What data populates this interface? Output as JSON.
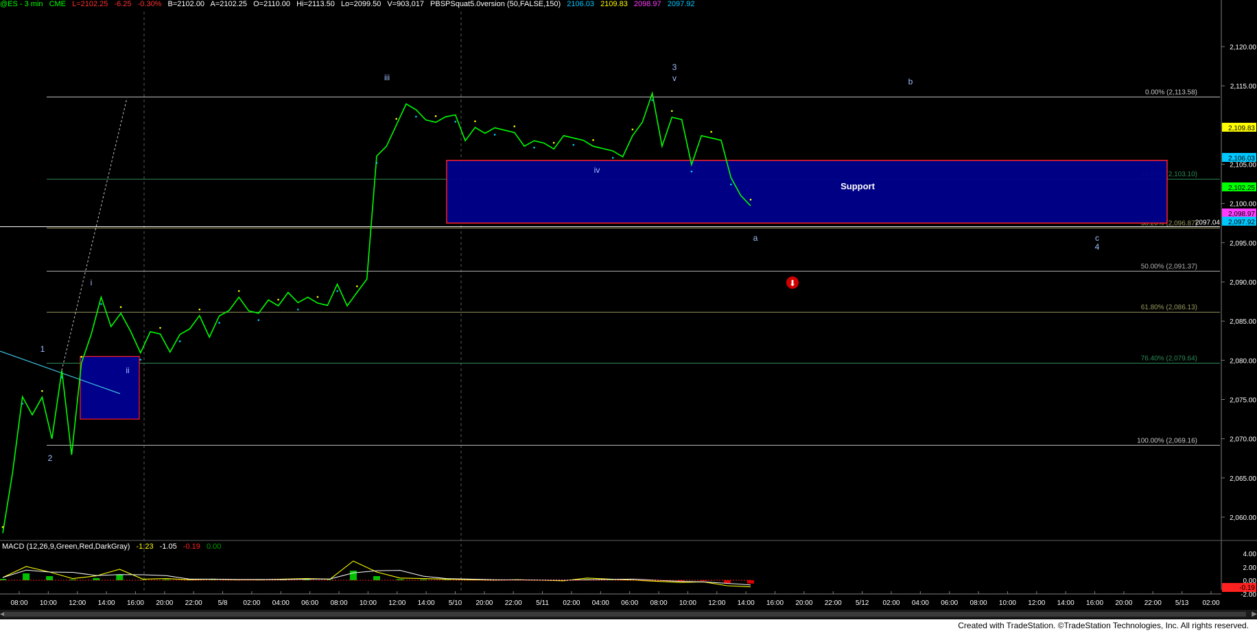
{
  "header": {
    "symbol": "@ES - 3 min",
    "exchange": "CME",
    "last": "L=2102.25",
    "change": "-6.25",
    "change_pct": "-0.30%",
    "bid": "B=2102.00",
    "ask": "A=2102.25",
    "open": "O=2110.00",
    "high": "Hi=2113.50",
    "low": "Lo=2099.50",
    "volume": "V=903,017",
    "indicator": "PBSPSquat5.0version (50,FALSE,150)",
    "ind_values": [
      {
        "text": "2106.03",
        "color": "#00c8ff"
      },
      {
        "text": "2109.83",
        "color": "#ffff00"
      },
      {
        "text": "2098.97",
        "color": "#ff3cff"
      },
      {
        "text": "2097.92",
        "color": "#00c8ff"
      }
    ]
  },
  "macd": {
    "label": "MACD (12,26,9,Green,Red,DarkGray)",
    "values": [
      {
        "text": "-1.23",
        "color": "#ffff00"
      },
      {
        "text": "-1.05",
        "color": "#ffffff"
      },
      {
        "text": "-0.19",
        "color": "#ff2020"
      },
      {
        "text": "0.00",
        "color": "#00a000"
      }
    ],
    "axis": [
      "4.00",
      "2.00",
      "0.00",
      "-2.00"
    ],
    "last_tag": "-0.19"
  },
  "price_axis": {
    "ticks": [
      "2,120.00",
      "2,115.00",
      "2,110.00",
      "2,105.00",
      "2,100.00",
      "2,095.00",
      "2,090.00",
      "2,085.00",
      "2,080.00",
      "2,075.00",
      "2,070.00",
      "2,065.00",
      "2,060.00"
    ],
    "tags": [
      {
        "text": "2,109.83",
        "value": 2109.83,
        "bg": "#ffff00",
        "fg": "#000000"
      },
      {
        "text": "2,106.03",
        "value": 2106.03,
        "bg": "#00c8ff",
        "fg": "#000000"
      },
      {
        "text": "2,102.25",
        "value": 2102.25,
        "bg": "#00ff00",
        "fg": "#000000"
      },
      {
        "text": "2,098.97",
        "value": 2098.97,
        "bg": "#ff3cff",
        "fg": "#000000"
      },
      {
        "text": "2,097.92",
        "value": 2097.92,
        "bg": "#00c8ff",
        "fg": "#000000"
      }
    ]
  },
  "time_axis": [
    "08:00",
    "10:00",
    "12:00",
    "14:00",
    "16:00",
    "20:00",
    "22:00",
    "5/8",
    "02:00",
    "04:00",
    "06:00",
    "08:00",
    "10:00",
    "12:00",
    "14:00",
    "5/10",
    "20:00",
    "22:00",
    "5/11",
    "02:00",
    "04:00",
    "06:00",
    "08:00",
    "10:00",
    "12:00",
    "14:00",
    "16:00",
    "20:00",
    "22:00",
    "5/12",
    "02:00",
    "04:00",
    "06:00",
    "08:00",
    "10:00",
    "12:00",
    "14:00",
    "16:00",
    "20:00",
    "22:00",
    "5/13",
    "02:00"
  ],
  "fib_levels": [
    {
      "label": "0.00% (2,113.58)",
      "value": 2113.58,
      "color": "#c8c8c8"
    },
    {
      "label": "23.60% (2,103.10)",
      "value": 2103.1,
      "color": "#2e8b57"
    },
    {
      "label": "38.20% (2,096.87)",
      "value": 2096.87,
      "color": "#9a9a60"
    },
    {
      "label": "50.00% (2,091.37)",
      "value": 2091.37,
      "color": "#b0b0b0"
    },
    {
      "label": "61.80% (2,086.13)",
      "value": 2086.13,
      "color": "#9a9a60"
    },
    {
      "label": "76.40% (2,079.64)",
      "value": 2079.64,
      "color": "#2e8b57"
    },
    {
      "label": "100.00% (2,069.16)",
      "value": 2069.16,
      "color": "#c8c8c8"
    }
  ],
  "hline_label": "2097.04",
  "support_label": "Support",
  "wave_labels": [
    {
      "text": "1",
      "color": "#a0c0ff"
    },
    {
      "text": "2",
      "color": "#a0c0ff"
    },
    {
      "text": "i",
      "color": "#a0c0ff"
    },
    {
      "text": "ii",
      "color": "#a0c0ff"
    },
    {
      "text": "iii",
      "color": "#a0c0ff"
    },
    {
      "text": "iv",
      "color": "#a0c0ff"
    },
    {
      "text": "v",
      "color": "#a0c0ff"
    },
    {
      "text": "3",
      "color": "#a0c0ff"
    },
    {
      "text": "a",
      "color": "#a0c0ff"
    },
    {
      "text": "b",
      "color": "#a0c0ff"
    },
    {
      "text": "c",
      "color": "#a0c0ff"
    },
    {
      "text": "4",
      "color": "#a0c0ff"
    }
  ],
  "chart_data": {
    "type": "line",
    "ylim": [
      2057,
      2123
    ],
    "series": [
      {
        "values": [
          2059,
          2066,
          2075,
          2072,
          2076,
          2070,
          2078,
          2069,
          2080,
          2083,
          2087,
          2085,
          2086,
          2083,
          2082,
          2084,
          2083,
          2080,
          2084,
          2084,
          2085,
          2084,
          2086,
          2086,
          2087,
          2087,
          2086,
          2087,
          2088,
          2089,
          2087,
          2087,
          2088,
          2087,
          2089,
          2088,
          2089,
          2090,
          2105,
          2108,
          2110,
          2112,
          2113,
          2111,
          2110,
          2110,
          2112,
          2108,
          2109,
          2110,
          2110,
          2109,
          2108,
          2108,
          2108,
          2107,
          2108,
          2109,
          2108,
          2107,
          2108,
          2107,
          2106,
          2107,
          2109,
          2110,
          2113,
          2108,
          2111,
          2110,
          2106,
          2109,
          2108,
          2107,
          2104,
          2101,
          2099
        ]
      }
    ],
    "macd": [
      0.5,
      2.5,
      1.5,
      0.3,
      0.8,
      2.0,
      0.2,
      0.3,
      0.1,
      0.2,
      0.1,
      0.1,
      0.2,
      0.3,
      0.2,
      3.5,
      1.5,
      0.4,
      0.3,
      0.2,
      0.1,
      0.0,
      0.1,
      0.0,
      -0.1,
      0.4,
      0.2,
      0.0,
      -0.2,
      -0.4,
      -0.3,
      -1.0,
      -1.2
    ],
    "macd_ylim": [
      -2.5,
      4.5
    ],
    "support_zone": [
      2097.5,
      2105.5
    ],
    "small_box": [
      2072.5,
      2080.5
    ]
  },
  "footer_text": "Created with TradeStation. ©TradeStation Technologies, Inc. All rights reserved."
}
